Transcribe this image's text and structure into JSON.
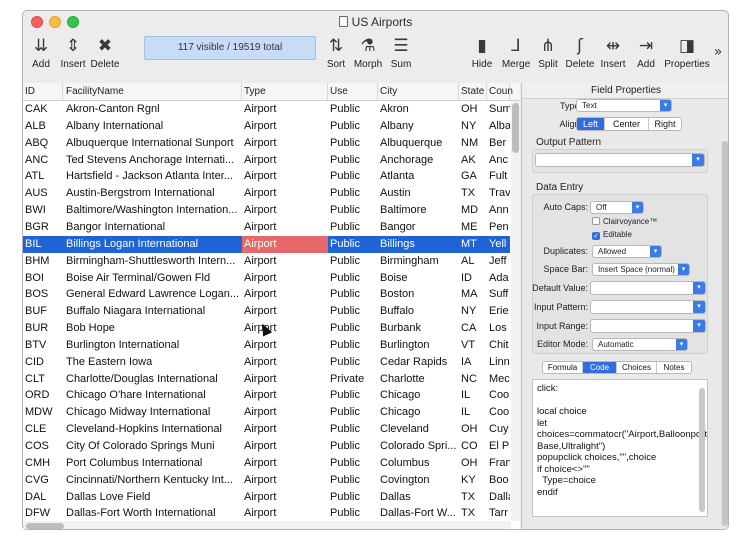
{
  "window": {
    "title": "US Airports"
  },
  "toolbar": {
    "counter": "117 visible / 19519 total",
    "left_buttons": [
      {
        "label": "Add",
        "icon": "add-record-icon",
        "glyph": "⇊"
      },
      {
        "label": "Insert",
        "icon": "insert-record-icon",
        "glyph": "⇕"
      },
      {
        "label": "Delete",
        "icon": "delete-icon",
        "glyph": "✖"
      }
    ],
    "mid_buttons": [
      {
        "label": "Sort",
        "icon": "sort-icon",
        "glyph": "⇅"
      },
      {
        "label": "Morph",
        "icon": "flask-icon",
        "glyph": "⚗"
      },
      {
        "label": "Sum",
        "icon": "sum-icon",
        "glyph": "☰"
      }
    ],
    "right_buttons": [
      {
        "label": "Hide",
        "icon": "bookmark-icon",
        "glyph": "▮"
      },
      {
        "label": "Merge",
        "icon": "merge-icon",
        "glyph": "⅃"
      },
      {
        "label": "Split",
        "icon": "split-icon",
        "glyph": "⋔"
      },
      {
        "label": "Delete",
        "icon": "delete-field-icon",
        "glyph": "ʃ"
      },
      {
        "label": "Insert",
        "icon": "insert-field-icon",
        "glyph": "⇹"
      },
      {
        "label": "Add",
        "icon": "add-field-icon",
        "glyph": "⇥"
      },
      {
        "label": "Properties",
        "icon": "properties-icon",
        "glyph": "◨"
      }
    ],
    "overflow": "»"
  },
  "table": {
    "columns": [
      "ID",
      "FacilityName",
      "Type",
      "Use",
      "City",
      "State",
      "Coun"
    ],
    "rows": [
      [
        "CAK",
        "Akron-Canton Rgnl",
        "Airport",
        "Public",
        "Akron",
        "OH",
        "Sum"
      ],
      [
        "ALB",
        "Albany International",
        "Airport",
        "Public",
        "Albany",
        "NY",
        "Alba"
      ],
      [
        "ABQ",
        "Albuquerque International Sunport",
        "Airport",
        "Public",
        "Albuquerque",
        "NM",
        "Ber"
      ],
      [
        "ANC",
        "Ted Stevens Anchorage Internati...",
        "Airport",
        "Public",
        "Anchorage",
        "AK",
        "Anc"
      ],
      [
        "ATL",
        "Hartsfield - Jackson Atlanta Inter...",
        "Airport",
        "Public",
        "Atlanta",
        "GA",
        "Fult"
      ],
      [
        "AUS",
        "Austin-Bergstrom International",
        "Airport",
        "Public",
        "Austin",
        "TX",
        "Trav"
      ],
      [
        "BWI",
        "Baltimore/Washington Internation...",
        "Airport",
        "Public",
        "Baltimore",
        "MD",
        "Ann"
      ],
      [
        "BGR",
        "Bangor International",
        "Airport",
        "Public",
        "Bangor",
        "ME",
        "Pen"
      ],
      [
        "BIL",
        "Billings Logan International",
        "Airport",
        "Public",
        "Billings",
        "MT",
        "Yell"
      ],
      [
        "BHM",
        "Birmingham-Shuttlesworth Intern...",
        "Airport",
        "Public",
        "Birmingham",
        "AL",
        "Jeff"
      ],
      [
        "BOI",
        "Boise Air Terminal/Gowen Fld",
        "Airport",
        "Public",
        "Boise",
        "ID",
        "Ada"
      ],
      [
        "BOS",
        "General Edward Lawrence Logan...",
        "Airport",
        "Public",
        "Boston",
        "MA",
        "Suff"
      ],
      [
        "BUF",
        "Buffalo Niagara International",
        "Airport",
        "Public",
        "Buffalo",
        "NY",
        "Erie"
      ],
      [
        "BUR",
        "Bob Hope",
        "Airport",
        "Public",
        "Burbank",
        "CA",
        "Los"
      ],
      [
        "BTV",
        "Burlington International",
        "Airport",
        "Public",
        "Burlington",
        "VT",
        "Chit"
      ],
      [
        "CID",
        "The Eastern Iowa",
        "Airport",
        "Public",
        "Cedar Rapids",
        "IA",
        "Linn"
      ],
      [
        "CLT",
        "Charlotte/Douglas International",
        "Airport",
        "Private",
        "Charlotte",
        "NC",
        "Mec"
      ],
      [
        "ORD",
        "Chicago O'hare International",
        "Airport",
        "Public",
        "Chicago",
        "IL",
        "Coo"
      ],
      [
        "MDW",
        "Chicago Midway International",
        "Airport",
        "Public",
        "Chicago",
        "IL",
        "Coo"
      ],
      [
        "CLE",
        "Cleveland-Hopkins International",
        "Airport",
        "Public",
        "Cleveland",
        "OH",
        "Cuy"
      ],
      [
        "COS",
        "City Of Colorado Springs Muni",
        "Airport",
        "Public",
        "Colorado Spri...",
        "CO",
        "El P"
      ],
      [
        "CMH",
        "Port Columbus International",
        "Airport",
        "Public",
        "Columbus",
        "OH",
        "Fran"
      ],
      [
        "CVG",
        "Cincinnati/Northern Kentucky Int...",
        "Airport",
        "Public",
        "Covington",
        "KY",
        "Boo"
      ],
      [
        "DAL",
        "Dallas Love Field",
        "Airport",
        "Public",
        "Dallas",
        "TX",
        "Dalla"
      ],
      [
        "DFW",
        "Dallas-Fort Worth International",
        "Airport",
        "Public",
        "Dallas-Fort W...",
        "TX",
        "Tarr"
      ]
    ],
    "selected_index": 8
  },
  "panel": {
    "title": "Field Properties",
    "type_label": "Type:",
    "type_value": "Text",
    "align_label": "Align:",
    "align_options": [
      "Left",
      "Center",
      "Right"
    ],
    "align_selected": 0,
    "output_pattern_label": "Output Pattern",
    "data_entry_label": "Data Entry",
    "auto_caps_label": "Auto Caps:",
    "auto_caps_value": "Off",
    "clairvoyance_label": "Clairvoyance™",
    "clairvoyance_checked": false,
    "editable_label": "Editable",
    "editable_checked": true,
    "duplicates_label": "Duplicates:",
    "duplicates_value": "Allowed",
    "spacebar_label": "Space Bar:",
    "spacebar_value": "Insert Space (normal)",
    "default_value_label": "Default Value:",
    "input_pattern_label": "Input Pattern:",
    "input_range_label": "Input Range:",
    "editor_mode_label": "Editor Mode:",
    "editor_mode_value": "Automatic",
    "tabs": [
      "Formula",
      "Code",
      "Choices",
      "Notes"
    ],
    "tab_selected": 1,
    "code": "click:\n\nlocal choice\nlet\nchoices=commatocr(\"Airport,Balloonport,Gliderport,Heliport,Seaplane Base,Ultralight\")\npopupclick choices,\"\",choice\nif choice<>\"\"\n  Type=choice\nendif"
  }
}
